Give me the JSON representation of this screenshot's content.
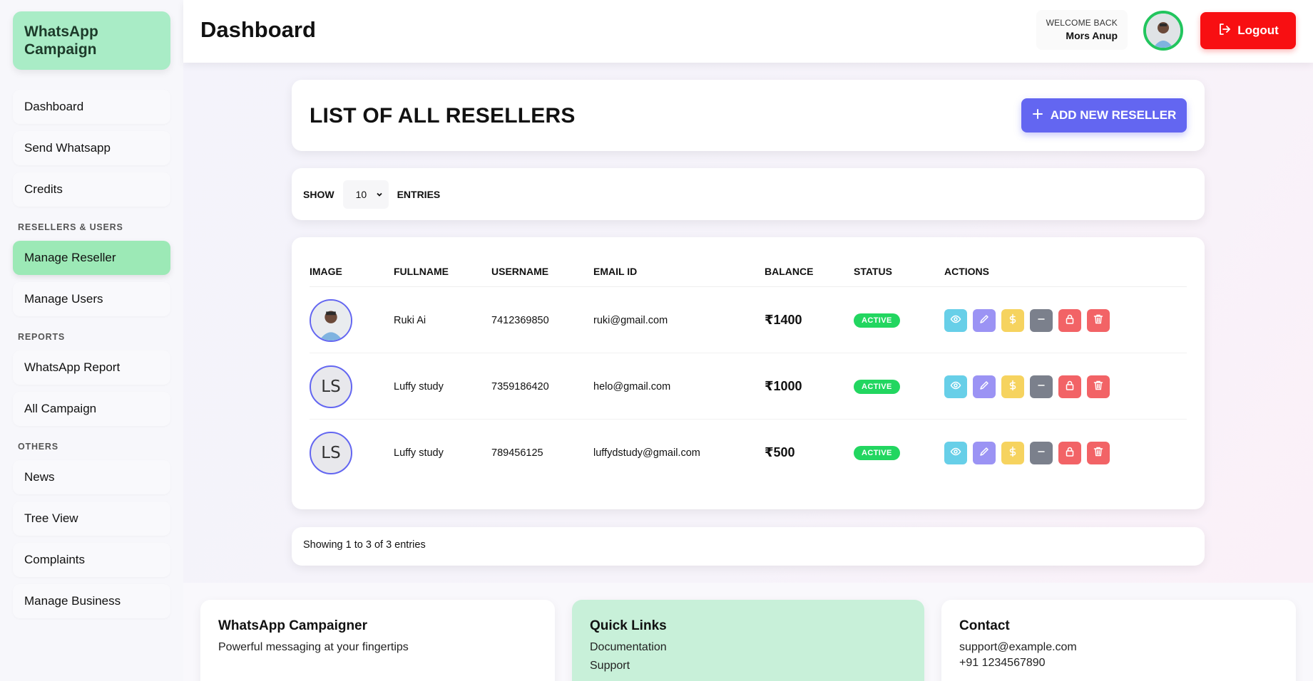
{
  "sidebar": {
    "brand": "WhatsApp Campaign",
    "items_main": [
      "Dashboard",
      "Send Whatsapp",
      "Credits"
    ],
    "section_resellers": "RESELLERS & USERS",
    "items_resellers": [
      "Manage Reseller",
      "Manage Users"
    ],
    "active_item": "Manage Reseller",
    "section_reports": "REPORTS",
    "items_reports": [
      "WhatsApp Report",
      "All Campaign"
    ],
    "section_others": "OTHERS",
    "items_others": [
      "News",
      "Tree View",
      "Complaints",
      "Manage Business"
    ]
  },
  "header": {
    "title": "Dashboard",
    "welcome_label": "WELCOME BACK",
    "user_name": "Mors Anup",
    "logout_label": "Logout"
  },
  "list": {
    "title": "LIST OF ALL RESELLERS",
    "add_button": "ADD NEW RESELLER",
    "show_label": "SHOW",
    "entries_value": "10",
    "entries_label": "ENTRIES"
  },
  "table": {
    "columns": [
      "IMAGE",
      "FULLNAME",
      "USERNAME",
      "EMAIL ID",
      "BALANCE",
      "STATUS",
      "ACTIONS"
    ],
    "rows": [
      {
        "image": "photo",
        "initials": "",
        "fullname": "Ruki Ai",
        "username": "7412369850",
        "email": "ruki@gmail.com",
        "balance": "₹1400",
        "status": "ACTIVE"
      },
      {
        "image": "initials",
        "initials": "LS",
        "fullname": "Luffy study",
        "username": "7359186420",
        "email": "helo@gmail.com",
        "balance": "₹1000",
        "status": "ACTIVE"
      },
      {
        "image": "initials",
        "initials": "LS",
        "fullname": "Luffy study",
        "username": "789456125",
        "email": "luffydstudy@gmail.com",
        "balance": "₹500",
        "status": "ACTIVE"
      }
    ],
    "action_icons": [
      "eye-icon",
      "pencil-icon",
      "dollar-icon",
      "minus-icon",
      "lock-icon",
      "trash-icon"
    ],
    "showing_text": "Showing 1 to 3 of 3 entries"
  },
  "footer": {
    "about_title": "WhatsApp Campaigner",
    "about_text": "Powerful messaging at your fingertips",
    "links_title": "Quick Links",
    "links": [
      "Documentation",
      "Support"
    ],
    "contact_title": "Contact",
    "contact_email": "support@example.com",
    "contact_phone": "+91 1234567890"
  },
  "colors": {
    "brand_green": "#a9ecc6",
    "active_green": "#9ce9b6",
    "primary": "#6366f1",
    "logout_red": "#f80f12",
    "status_green": "#22d660"
  }
}
